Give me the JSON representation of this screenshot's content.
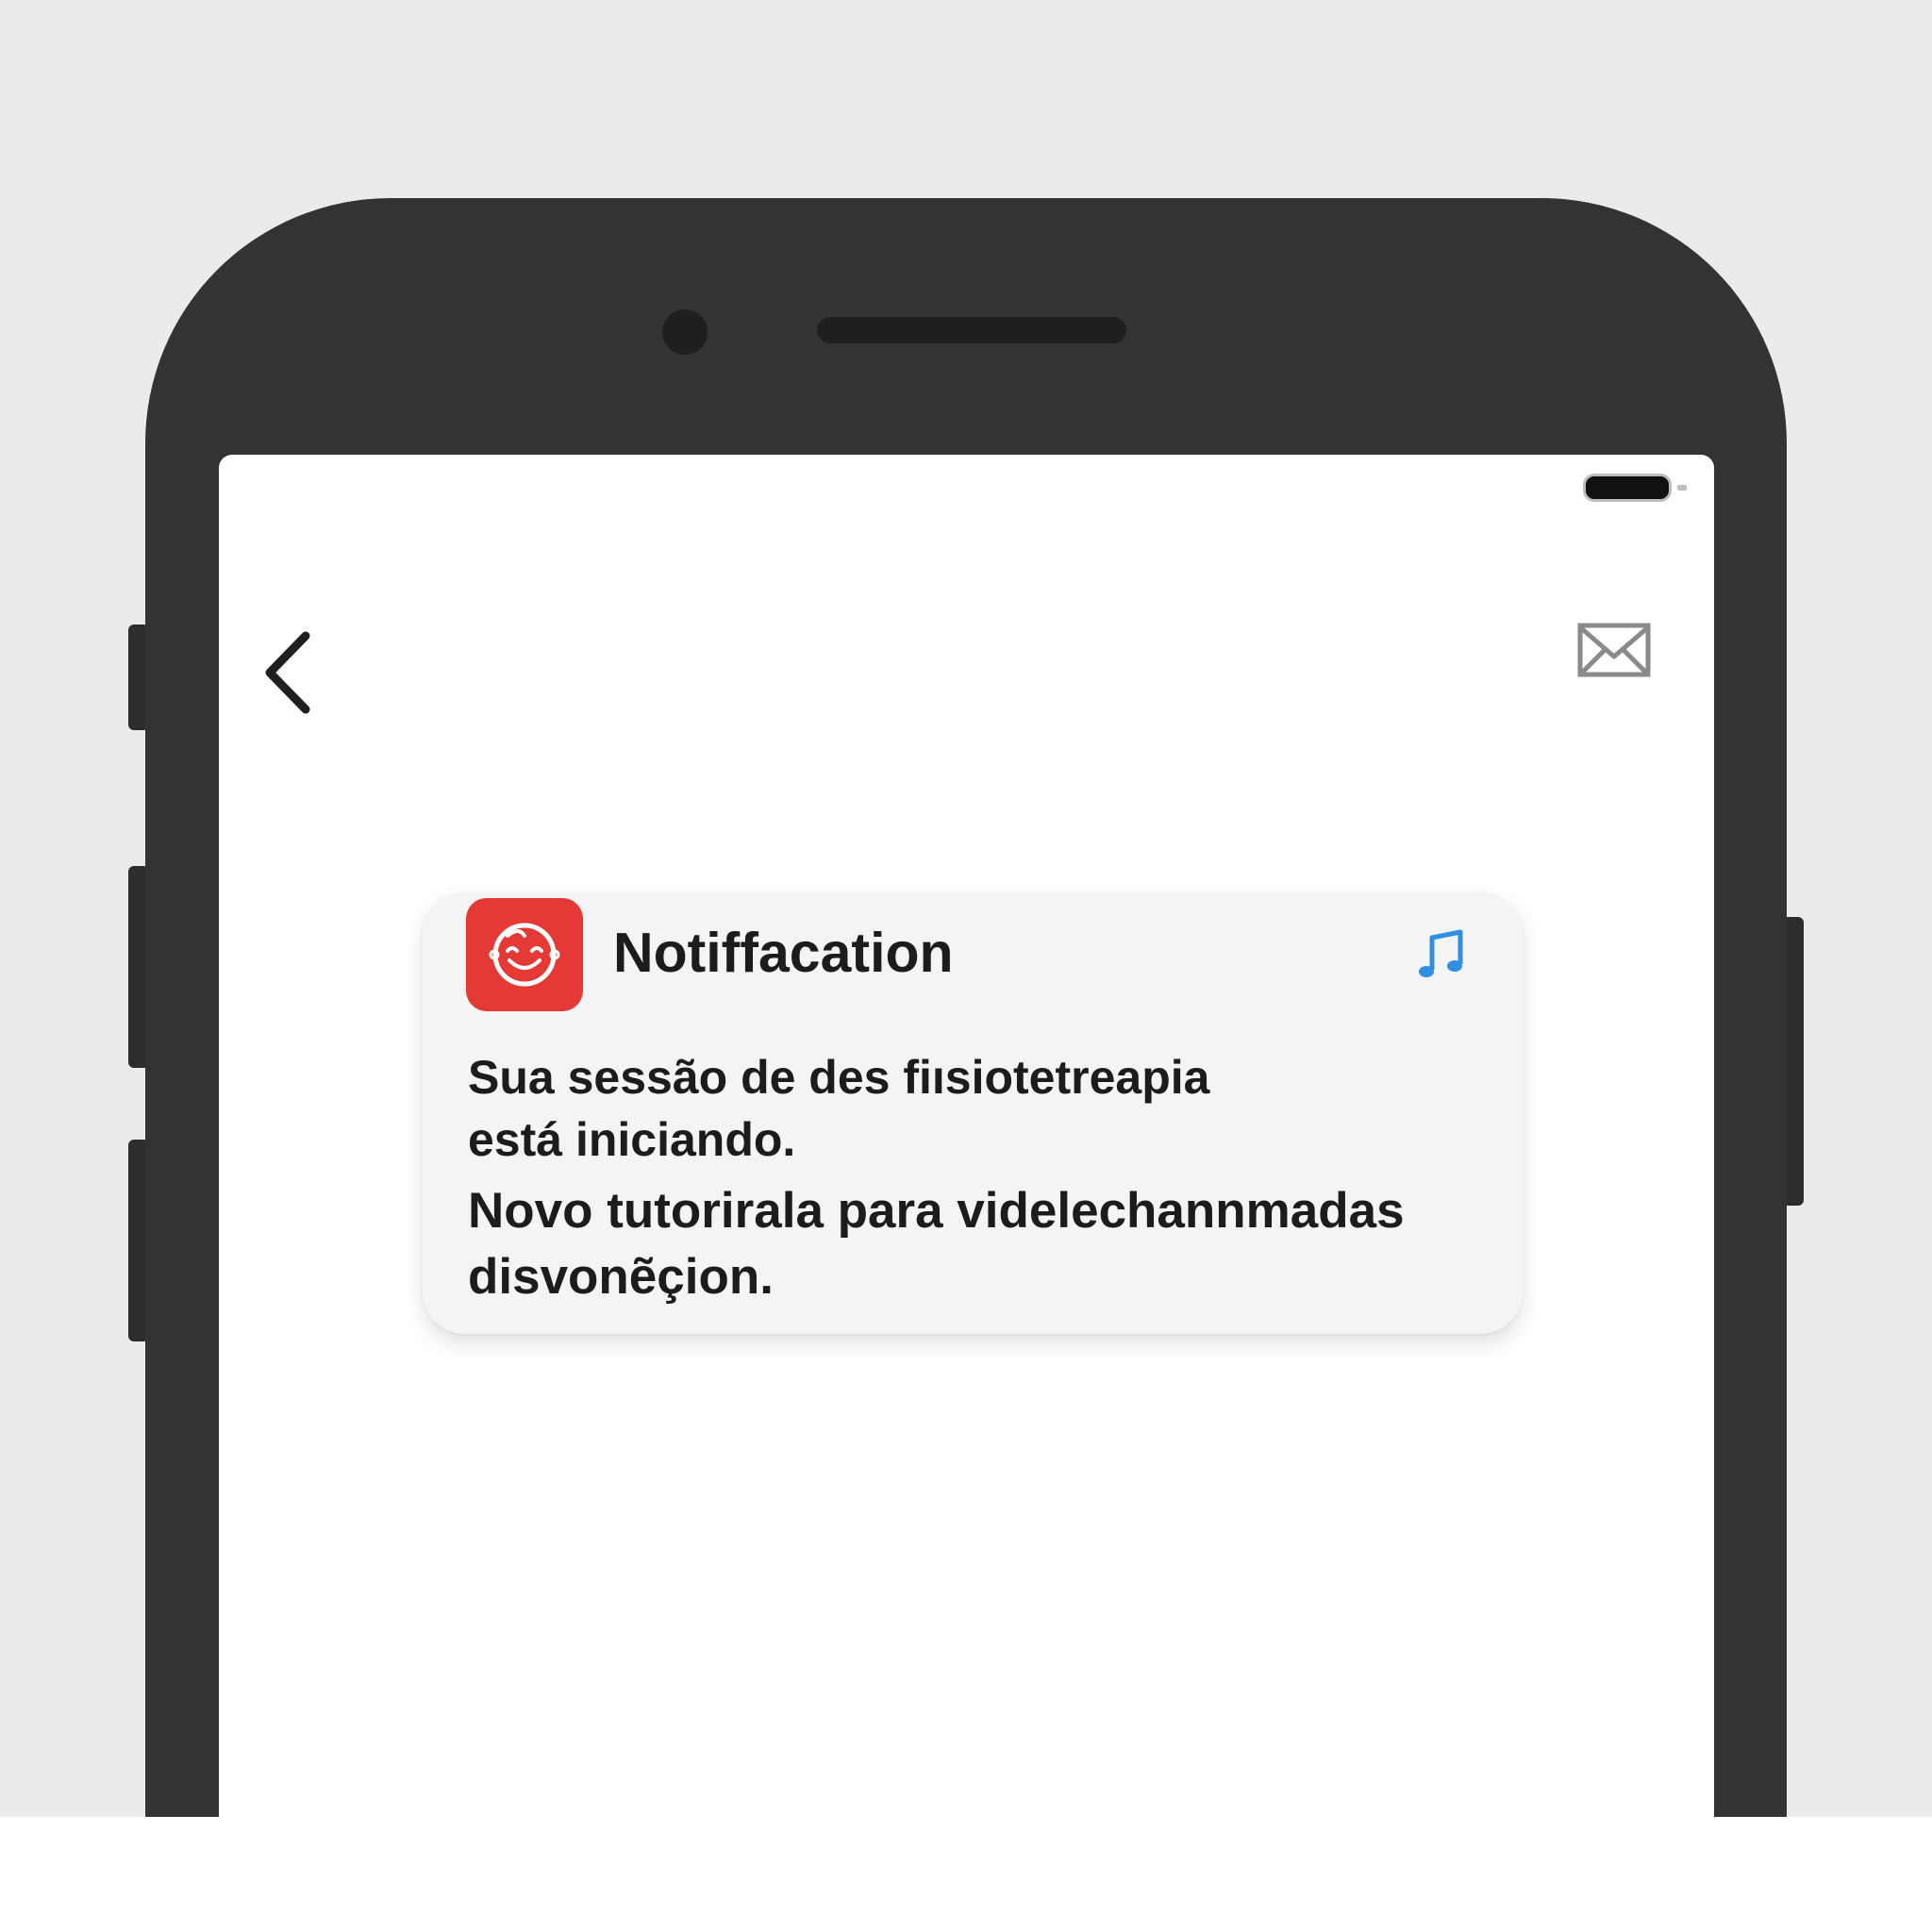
{
  "status_bar": {
    "battery_icon": "battery-full-icon"
  },
  "toolbar": {
    "back_icon": "chevron-left-icon",
    "mail_icon": "envelope-icon"
  },
  "notification": {
    "app_icon": "smiling-face-icon",
    "app_icon_color": "#e53935",
    "title": "Notiffacation",
    "sound_icon": "music-note-icon",
    "sound_icon_color": "#2f8fe0",
    "body_lines": [
      "Sua sessão de des fiısiotetreapia",
      "está iniciando.",
      "Novo tutorirala para videlechannmadas",
      "disvonẽçion."
    ]
  }
}
